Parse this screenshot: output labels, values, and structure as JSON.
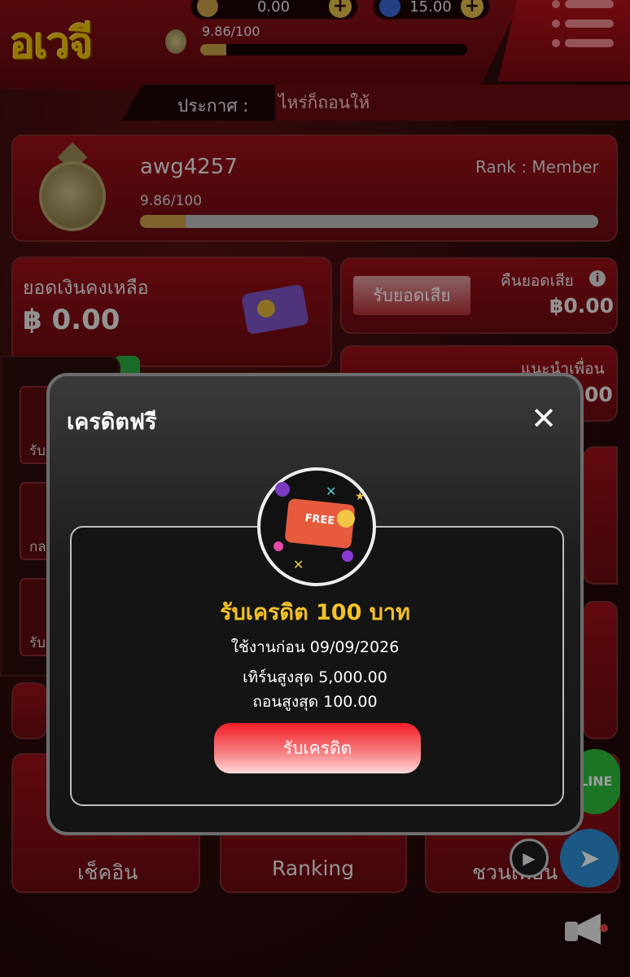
{
  "header": {
    "logo_text": "อเวจี",
    "coin_balance": "0.00",
    "gem_balance": "15.00",
    "level": "9.86/100",
    "level_progress": 0.0986,
    "announce_label": "ประกาศ :",
    "announce_text": "ไหร่ก็ถอนให้"
  },
  "profile": {
    "username": "awg4257",
    "rank": "Rank : Member",
    "level": "9.86/100",
    "level_progress": 0.0986
  },
  "balance": {
    "label": "ยอดเงินคงเหลือ",
    "value": "฿ 0.00"
  },
  "cashback": {
    "button": "รับยอดเสีย",
    "label": "คืนยอดเสีย",
    "value": "฿0.00"
  },
  "referral": {
    "label": "แนะนำเพื่อน",
    "value_partial": "00"
  },
  "left_panel": {
    "item1": "รับ",
    "item2": "กล",
    "item3": "รับ"
  },
  "bottom_nav": {
    "checkin": "เช็คอิน",
    "ranking": "Ranking",
    "invite": "ชวนเพื่อน"
  },
  "floating": {
    "line": "LINE"
  },
  "modal": {
    "title": "เครดิตฟรี",
    "badge_text": "FREE",
    "amount": "รับเครดิต 100 บาท",
    "expire": "ใช้งานก่อน 09/09/2026",
    "max_turnover": "เทิร์นสูงสุด 5,000.00",
    "max_withdraw": "ถอนสูงสุด 100.00",
    "claim_button": "รับเครดิต"
  },
  "colors": {
    "accent_gold": "#f4c227",
    "brand_red": "#9c1018",
    "progress": "#c9a247"
  }
}
